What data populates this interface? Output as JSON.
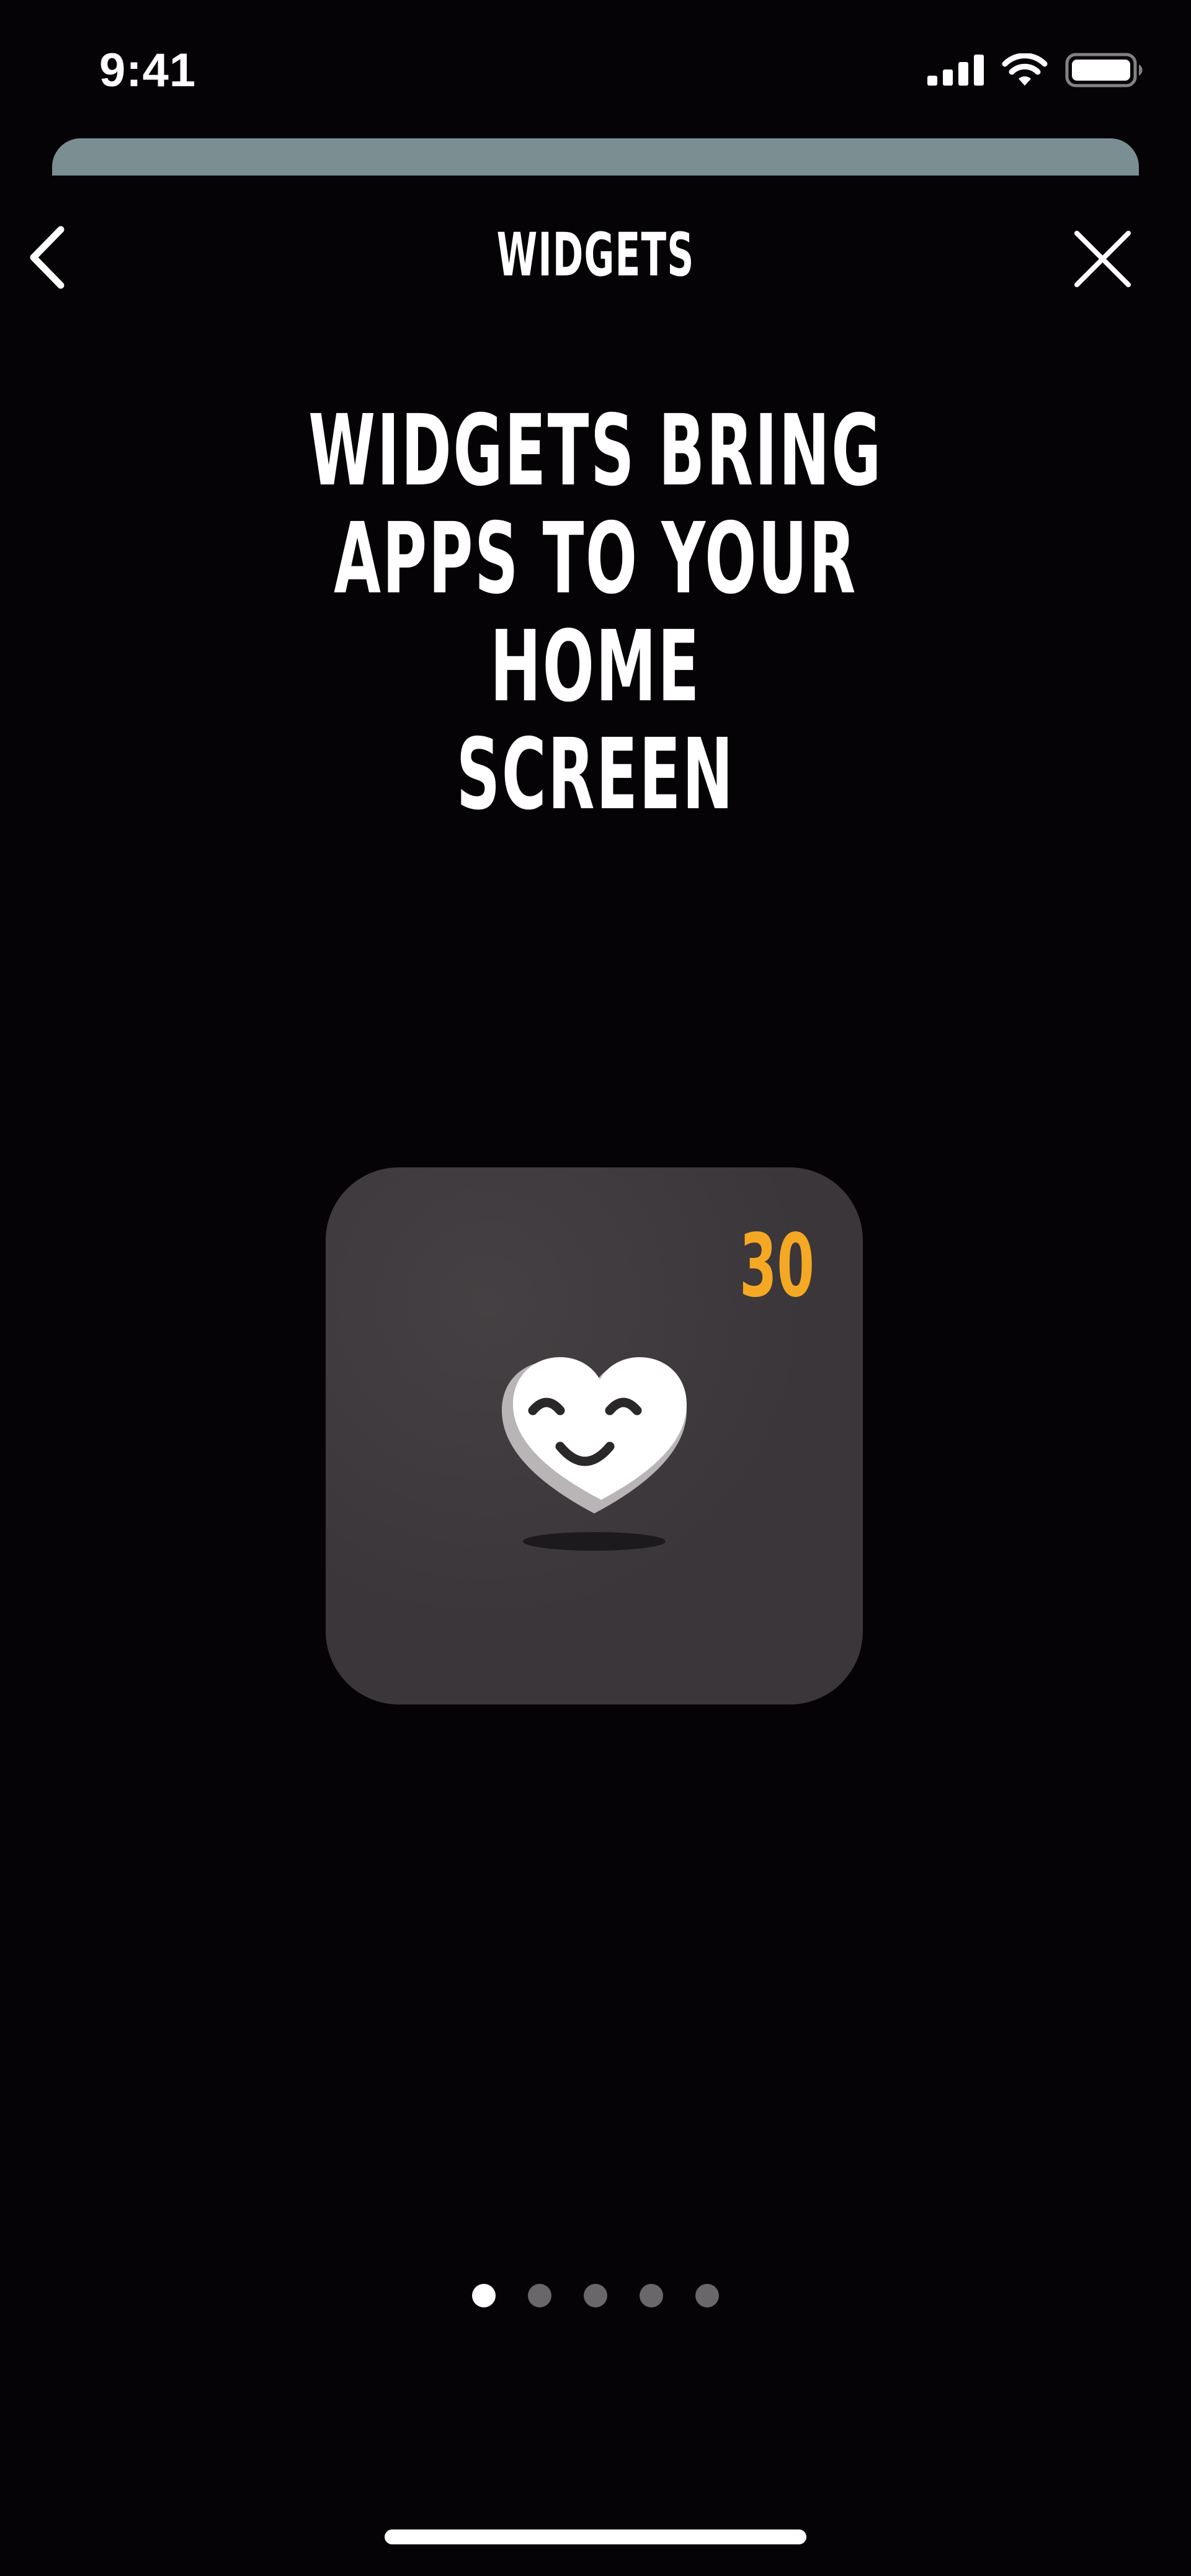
{
  "status_bar": {
    "time": "9:41",
    "icons": [
      "cellular-signal-icon",
      "wifi-icon",
      "battery-icon"
    ]
  },
  "nav": {
    "back_icon": "chevron-left-icon",
    "title": "WIDGETS",
    "close_icon": "close-icon"
  },
  "headline": "WIDGETS BRING\nAPPS TO YOUR HOME\nSCREEN",
  "widget": {
    "count": "30",
    "count_color": "#f5a823",
    "mascot_icon": "heart-smile-icon",
    "card_color": "#3a3639"
  },
  "pagination": {
    "total": 5,
    "active_index": 0
  },
  "colors": {
    "background": "#050306",
    "sheet_edge": "#7b8f92",
    "text": "#ffffff"
  }
}
